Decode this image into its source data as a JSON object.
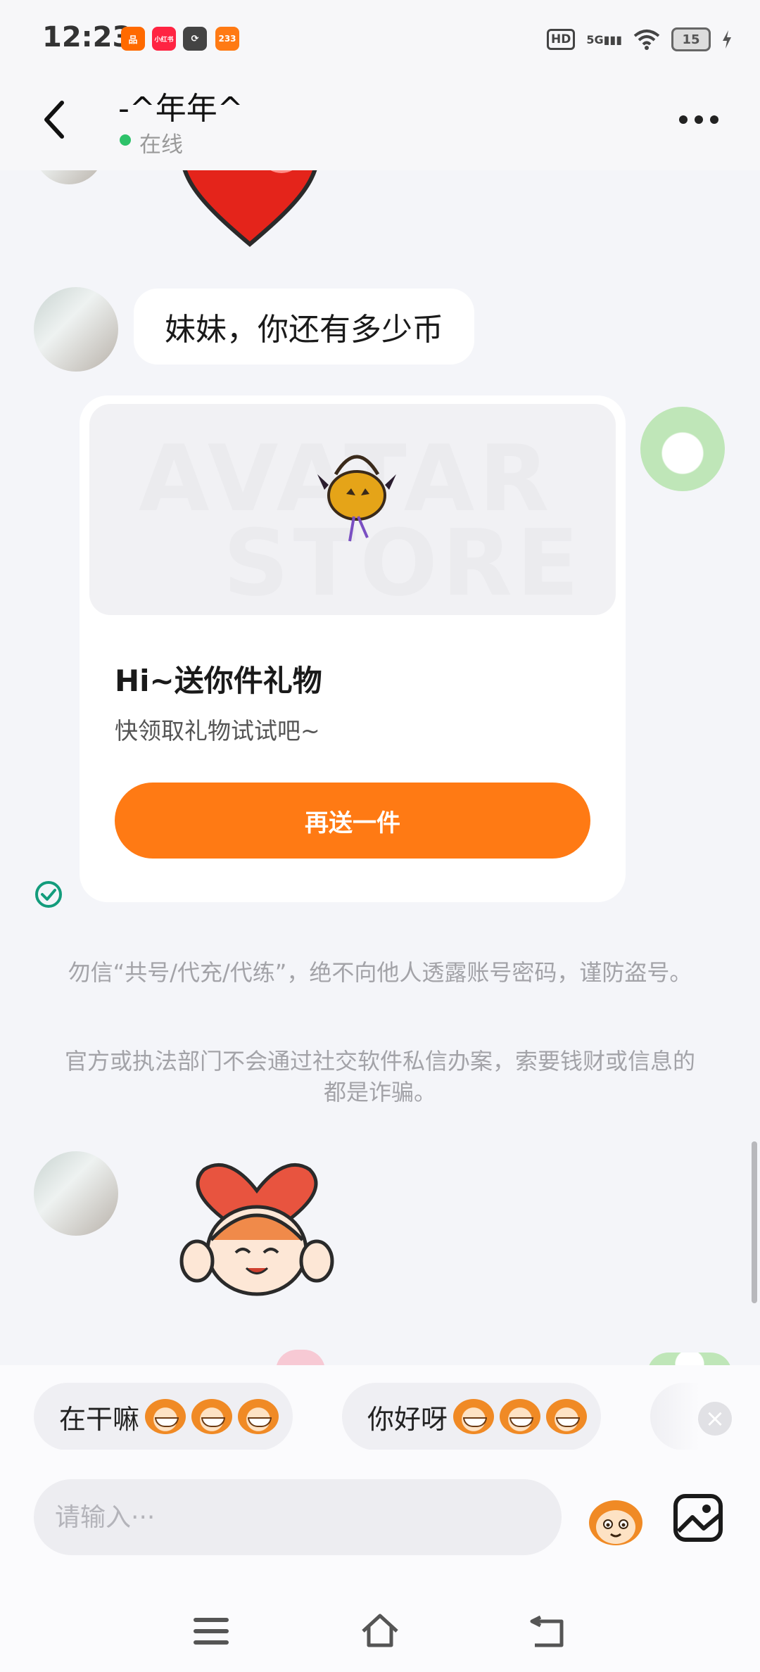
{
  "status_bar": {
    "time": "12:23",
    "apps": [
      {
        "label": "品",
        "color": "#ff6a00"
      },
      {
        "label": "小红书",
        "color": "#ff2442"
      },
      {
        "label": "⟳",
        "color": "#444444"
      },
      {
        "label": "233",
        "color": "#ff7a14"
      }
    ],
    "hd": "HD",
    "network": "5G",
    "battery": "15"
  },
  "header": {
    "title": "-^年年^",
    "status": "在线"
  },
  "messages": {
    "text_message": "妹妹，你还有多少币",
    "gift_card": {
      "watermark_line1": "AVATAR",
      "watermark_line2": "STORE",
      "title": "Hi~送你件礼物",
      "subtitle": "快领取礼物试试吧~",
      "button": "再送一件"
    },
    "notice_1": "勿信“共号/代充/代练”，绝不向他人透露账号密码，谨防盗号。",
    "notice_2": "官方或执法部门不会通过社交软件私信办案，索要钱财或信息的都是诈骗。"
  },
  "quick_replies": [
    {
      "label": "在干嘛"
    },
    {
      "label": "你好呀"
    }
  ],
  "input": {
    "placeholder": "请输入···"
  },
  "colors": {
    "accent": "#ff7a14",
    "online": "#2ec26a",
    "background": "#f4f5f9"
  }
}
